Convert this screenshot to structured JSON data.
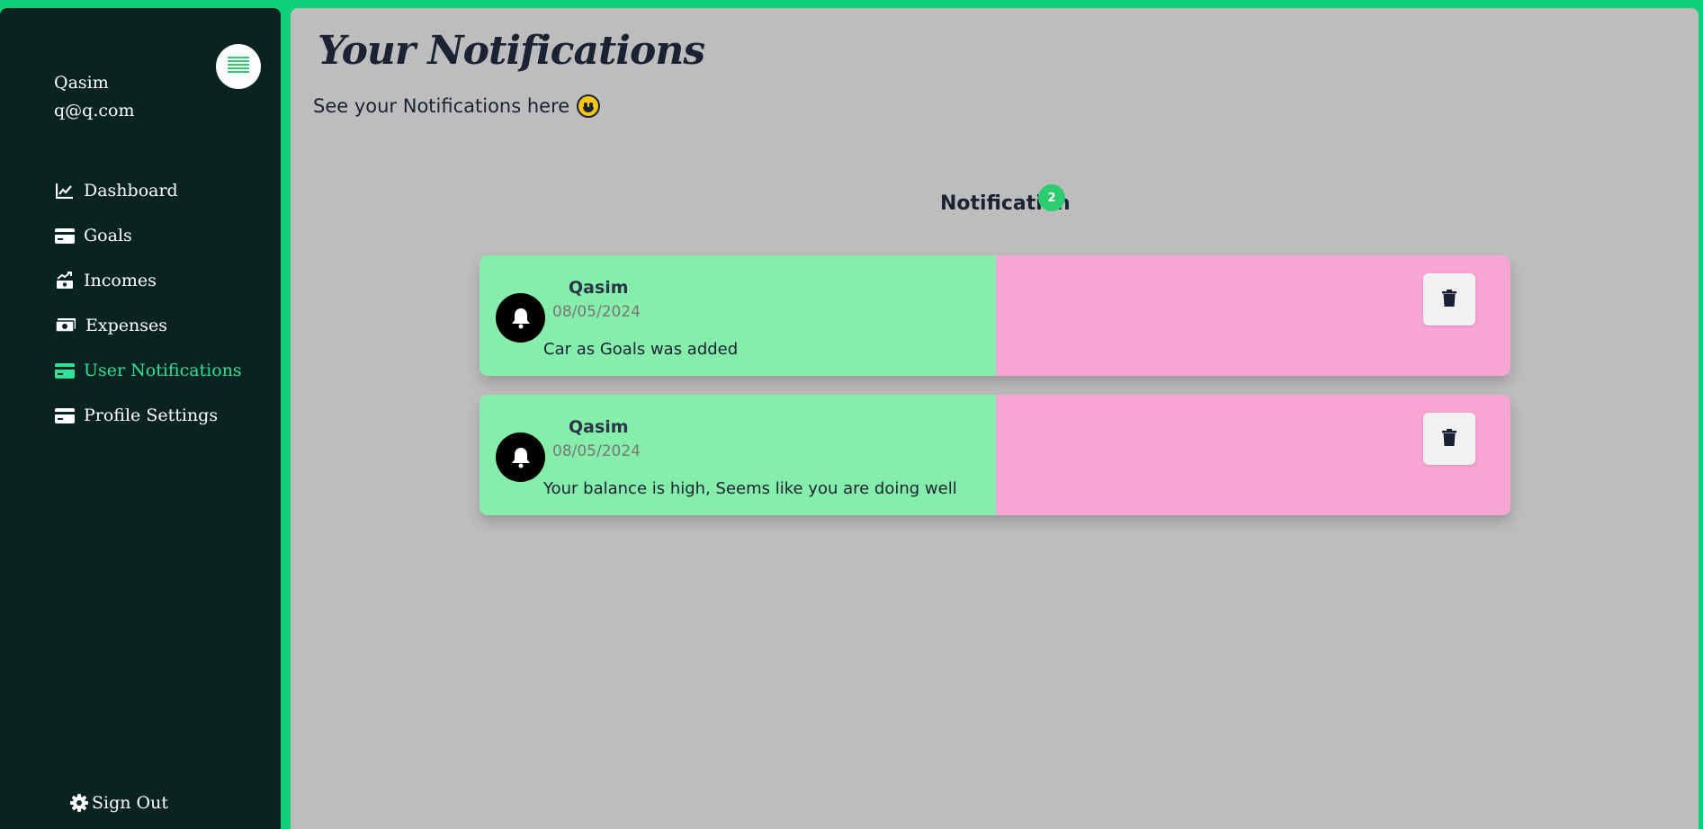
{
  "sidebar": {
    "user_name": "Qasim",
    "user_email": "q@q.com",
    "items": [
      {
        "label": "Dashboard",
        "icon": "chart-line-icon",
        "active": false
      },
      {
        "label": "Goals",
        "icon": "credit-card-icon",
        "active": false
      },
      {
        "label": "Incomes",
        "icon": "money-trend-icon",
        "active": false
      },
      {
        "label": "Expenses",
        "icon": "money-bill-icon",
        "active": false
      },
      {
        "label": "User Notifications",
        "icon": "credit-card-icon",
        "active": true
      },
      {
        "label": "Profile Settings",
        "icon": "credit-card-icon",
        "active": false
      }
    ],
    "sign_out": "Sign Out"
  },
  "main": {
    "title": "Your Notifications",
    "subtitle": "See your Notifications here"
  },
  "notifications": {
    "header": "Notification",
    "count": "2",
    "items": [
      {
        "name": "Qasim",
        "date": "08/05/2024",
        "message": "Car as Goals was added"
      },
      {
        "name": "Qasim",
        "date": "08/05/2024",
        "message": "Your balance is high, Seems like you are doing well"
      }
    ]
  },
  "colors": {
    "accent": "#10d07a",
    "sidebar_bg": "#092420",
    "active_nav": "#2ee29a",
    "card_left": "#86eeab",
    "card_right": "#f7a6d4",
    "badge": "#2ecc71"
  }
}
